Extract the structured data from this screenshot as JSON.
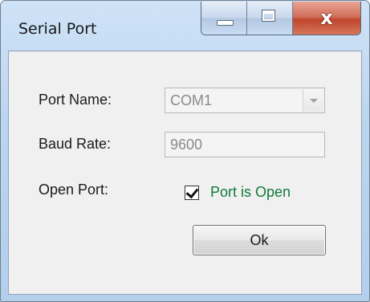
{
  "window": {
    "title": "Serial Port",
    "caption_buttons": {
      "minimize_icon": "minimize-icon",
      "maximize_icon": "maximize-icon",
      "close_icon": "close-icon",
      "close_glyph": "x"
    }
  },
  "form": {
    "port_name_label": "Port Name:",
    "port_name_value": "COM1",
    "baud_rate_label": "Baud Rate:",
    "baud_rate_value": "9600",
    "open_port_label": "Open Port:",
    "port_open_checked": true,
    "port_open_text": "Port is Open",
    "ok_label": "Ok"
  },
  "colors": {
    "status_text": "#127a3a",
    "disabled_text": "#8a8a8a",
    "close_button": "#c0462c"
  }
}
